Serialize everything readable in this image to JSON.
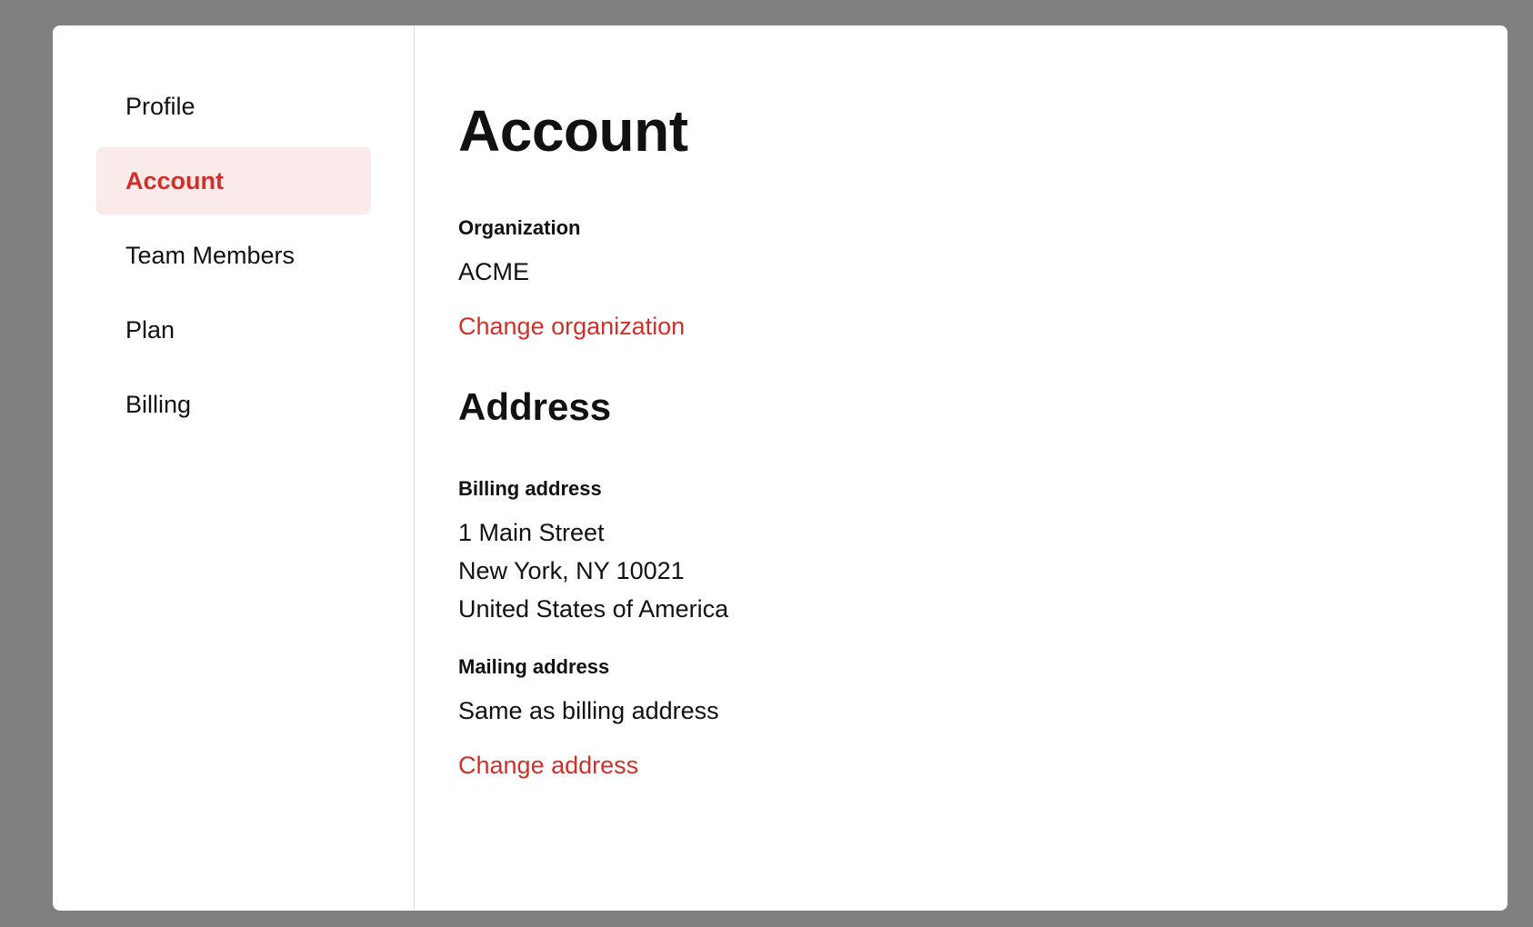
{
  "sidebar": {
    "items": [
      {
        "label": "Profile"
      },
      {
        "label": "Account"
      },
      {
        "label": "Team Members"
      },
      {
        "label": "Plan"
      },
      {
        "label": "Billing"
      }
    ]
  },
  "main": {
    "title": "Account",
    "organization": {
      "label": "Organization",
      "value": "ACME",
      "change_link": "Change organization"
    },
    "address": {
      "title": "Address",
      "billing": {
        "label": "Billing address",
        "lines": [
          "1 Main Street",
          "New York, NY 10021",
          "United States of America"
        ]
      },
      "mailing": {
        "label": "Mailing address",
        "value": "Same as billing address"
      },
      "change_link": "Change address"
    }
  },
  "colors": {
    "accent": "#d0302a",
    "active_bg": "#fbeaea",
    "backdrop": "#808080"
  }
}
